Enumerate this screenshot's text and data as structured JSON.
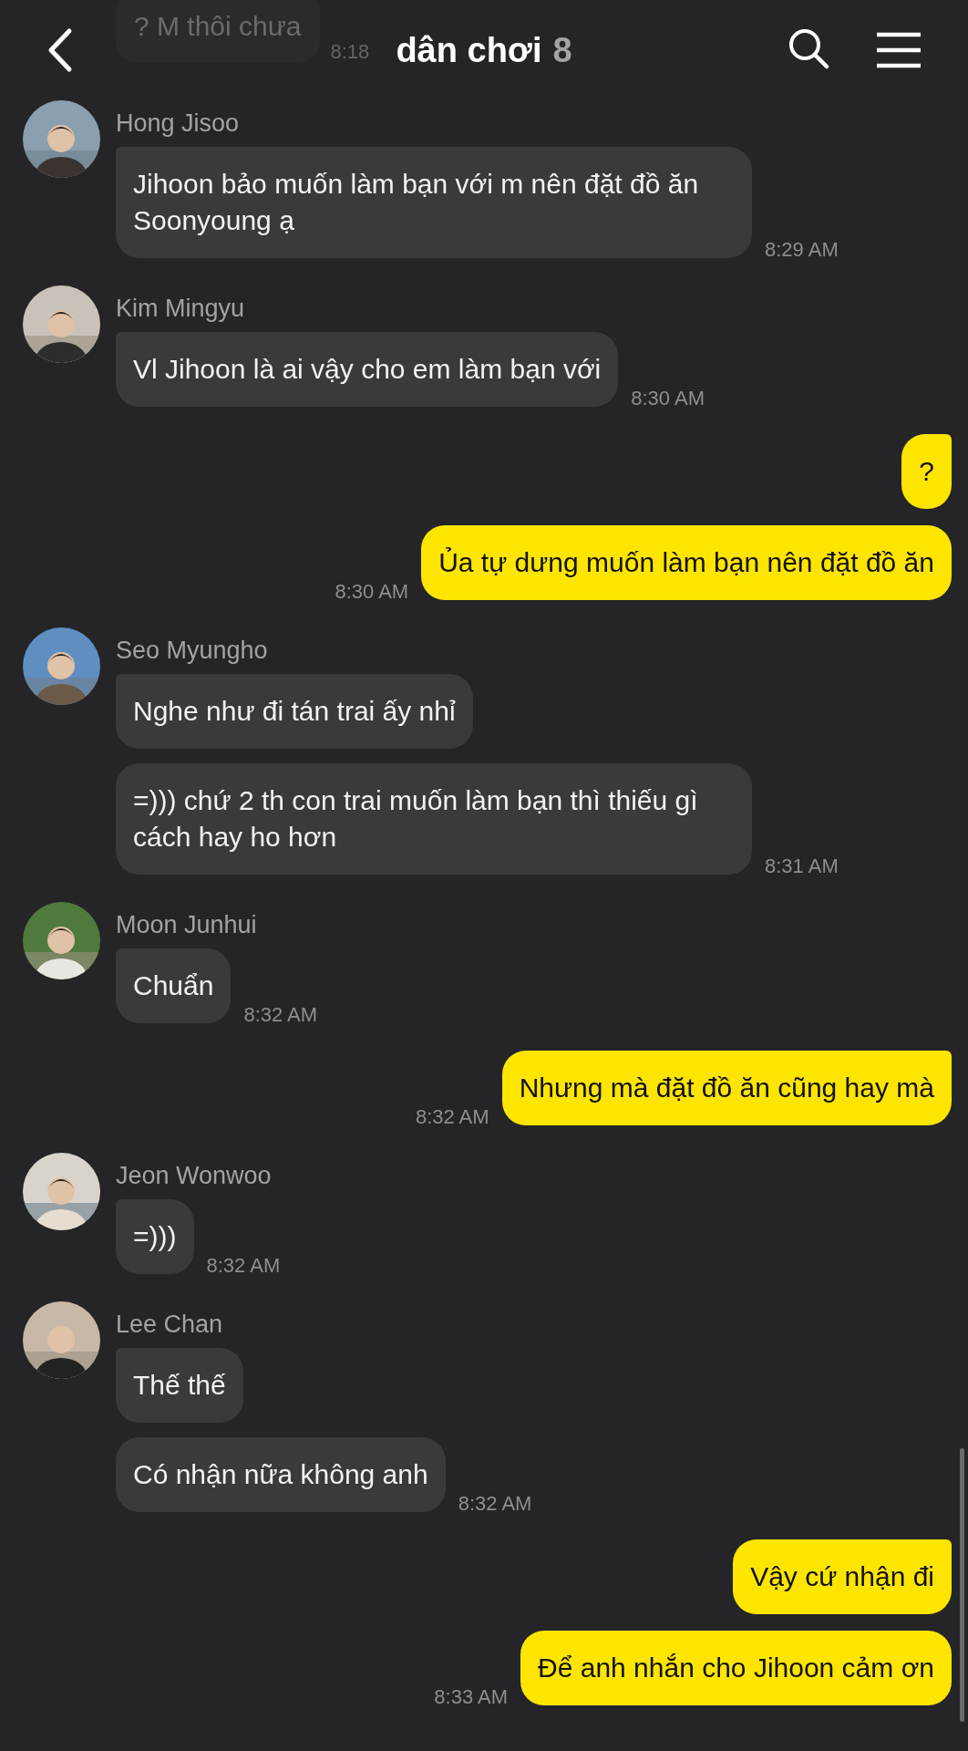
{
  "header": {
    "title": "dân chơi",
    "member_count": "8",
    "faded_message": {
      "text": "? M thôi chưa",
      "time": "8:18"
    }
  },
  "messages": [
    {
      "kind": "incoming",
      "sender": "Hong Jisoo",
      "avatar": {
        "kind": "picture"
      },
      "bubbles": [
        {
          "text": "Jihoon bảo muốn làm bạn với m nên đặt đồ ăn Soonyoung ạ",
          "time": "8:29 AM"
        }
      ]
    },
    {
      "kind": "incoming",
      "sender": "Kim Mingyu",
      "avatar": {
        "kind": "picture"
      },
      "bubbles": [
        {
          "text": "Vl Jihoon là ai vậy cho em làm bạn với",
          "time": "8:30 AM"
        }
      ]
    },
    {
      "kind": "outgoing",
      "bubbles": [
        {
          "text": "?"
        },
        {
          "text": "Ủa tự dưng muốn làm bạn nên đặt đồ ăn",
          "time": "8:30 AM"
        }
      ]
    },
    {
      "kind": "incoming",
      "sender": "Seo Myungho",
      "avatar": {
        "kind": "picture"
      },
      "bubbles": [
        {
          "text": "Nghe như đi tán trai ấy nhỉ"
        },
        {
          "text": "=))) chứ 2 th con trai muốn làm bạn thì thiếu gì cách hay ho hơn",
          "time": "8:31 AM"
        }
      ]
    },
    {
      "kind": "incoming",
      "sender": "Moon Junhui",
      "avatar": {
        "kind": "picture"
      },
      "bubbles": [
        {
          "text": "Chuẩn",
          "time": "8:32 AM"
        }
      ]
    },
    {
      "kind": "outgoing",
      "bubbles": [
        {
          "text": "Nhưng mà đặt đồ ăn cũng hay mà",
          "time": "8:32 AM"
        }
      ]
    },
    {
      "kind": "incoming",
      "sender": "Jeon Wonwoo",
      "avatar": {
        "kind": "picture"
      },
      "bubbles": [
        {
          "text": "=)))",
          "time": "8:32 AM"
        }
      ]
    },
    {
      "kind": "incoming",
      "sender": "Lee Chan",
      "avatar": {
        "kind": "picture"
      },
      "bubbles": [
        {
          "text": "Thế thế"
        },
        {
          "text": "Có nhận nữa không anh",
          "time": "8:32 AM"
        }
      ]
    },
    {
      "kind": "outgoing",
      "bubbles": [
        {
          "text": "Vậy cứ nhận đi"
        },
        {
          "text": "Để anh nhắn cho Jihoon cảm ơn",
          "time": "8:33 AM"
        }
      ]
    }
  ]
}
